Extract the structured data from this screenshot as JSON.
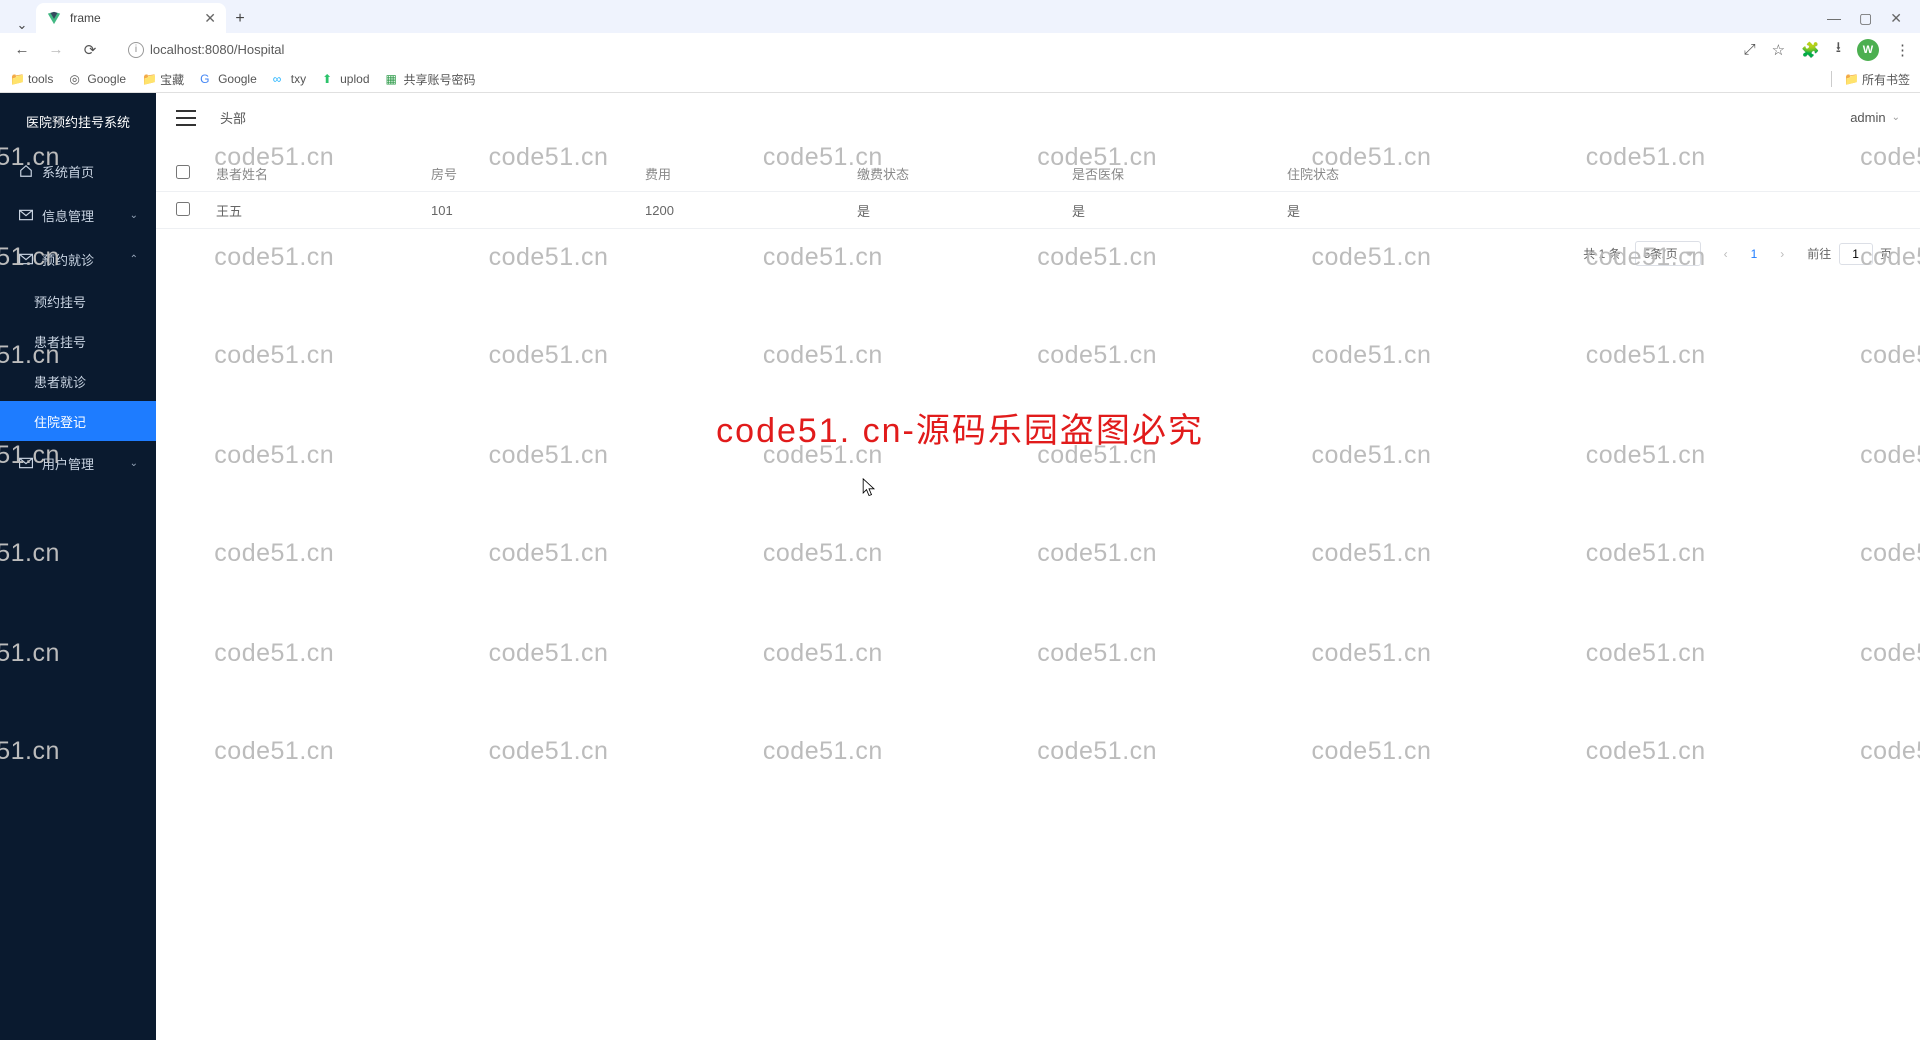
{
  "browser": {
    "tab_title": "frame",
    "url": "localhost:8080/Hospital",
    "bookmarks": [
      "tools",
      "Google",
      "宝藏",
      "Google",
      "txy",
      "uplod",
      "共享账号密码"
    ],
    "all_bookmarks": "所有书签",
    "avatar_letter": "W"
  },
  "sidebar": {
    "title": "医院预约挂号系统",
    "items": [
      {
        "label": "系统首页",
        "icon": "home"
      },
      {
        "label": "信息管理",
        "icon": "mail",
        "arrow": "down"
      },
      {
        "label": "预约就诊",
        "icon": "mail",
        "arrow": "up",
        "children": [
          {
            "label": "预约挂号"
          },
          {
            "label": "患者挂号"
          },
          {
            "label": "患者就诊"
          },
          {
            "label": "住院登记",
            "active": true
          }
        ]
      },
      {
        "label": "用户管理",
        "icon": "mail",
        "arrow": "down"
      }
    ]
  },
  "topbar": {
    "breadcrumb": "头部",
    "user": "admin"
  },
  "table": {
    "headers": {
      "name": "患者姓名",
      "room": "房号",
      "fee": "费用",
      "pay": "缴费状态",
      "ins": "是否医保",
      "stat": "住院状态"
    },
    "rows": [
      {
        "name": "王五",
        "room": "101",
        "fee": "1200",
        "pay": "是",
        "ins": "是",
        "stat": "是"
      }
    ]
  },
  "pagination": {
    "total": "共 1 条",
    "page_size": "5条/页",
    "current": "1",
    "goto_prefix": "前往",
    "goto_value": "1",
    "goto_suffix": "页"
  },
  "watermark": {
    "small": "code51.cn",
    "big": "code51. cn-源码乐园盗图必究"
  }
}
